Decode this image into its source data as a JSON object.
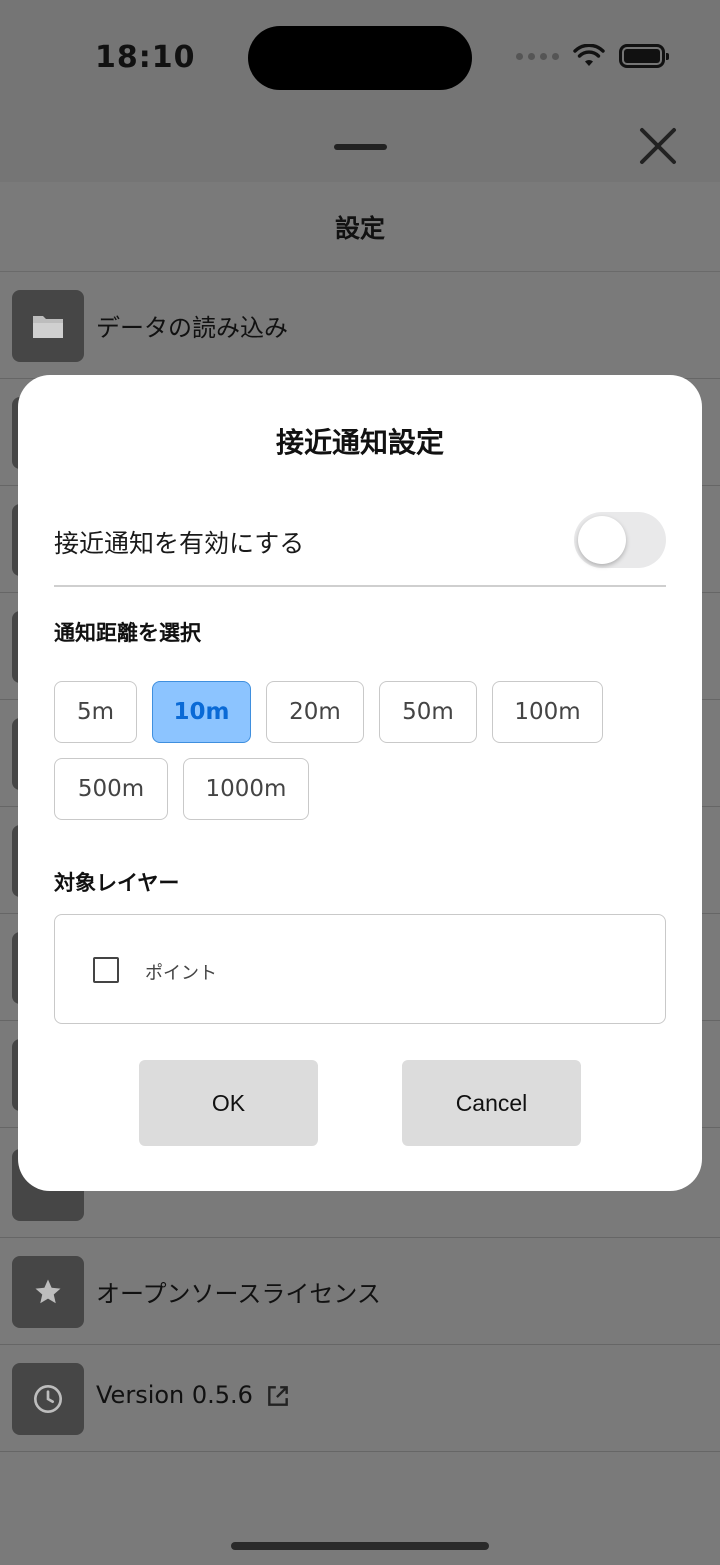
{
  "status_bar": {
    "time": "18:10"
  },
  "settings": {
    "title": "設定",
    "rows": [
      {
        "label": "データの読み込み",
        "icon": "folder-icon"
      },
      {
        "label": "",
        "icon": ""
      },
      {
        "label": "",
        "icon": ""
      },
      {
        "label": "",
        "icon": ""
      },
      {
        "label": "",
        "icon": ""
      },
      {
        "label": "",
        "icon": ""
      },
      {
        "label": "",
        "icon": ""
      },
      {
        "label": "",
        "icon": ""
      },
      {
        "label": "",
        "icon": "help-icon"
      },
      {
        "label": "オープンソースライセンス",
        "icon": "star-icon"
      },
      {
        "label": "Version 0.5.6",
        "icon": "clock-icon"
      }
    ]
  },
  "dialog": {
    "title": "接近通知設定",
    "enable_label": "接近通知を有効にする",
    "enable_on": false,
    "distance_label": "通知距離を選択",
    "distances": [
      "5m",
      "10m",
      "20m",
      "50m",
      "100m",
      "500m",
      "1000m"
    ],
    "selected_distance": "10m",
    "layer_label": "対象レイヤー",
    "layers": [
      {
        "label": "ポイント",
        "checked": false
      }
    ],
    "ok_label": "OK",
    "cancel_label": "Cancel"
  },
  "colors": {
    "accent_fill": "#8cc4ff",
    "accent_text": "#0a6ad6",
    "overlay": "#7a7a7a"
  }
}
